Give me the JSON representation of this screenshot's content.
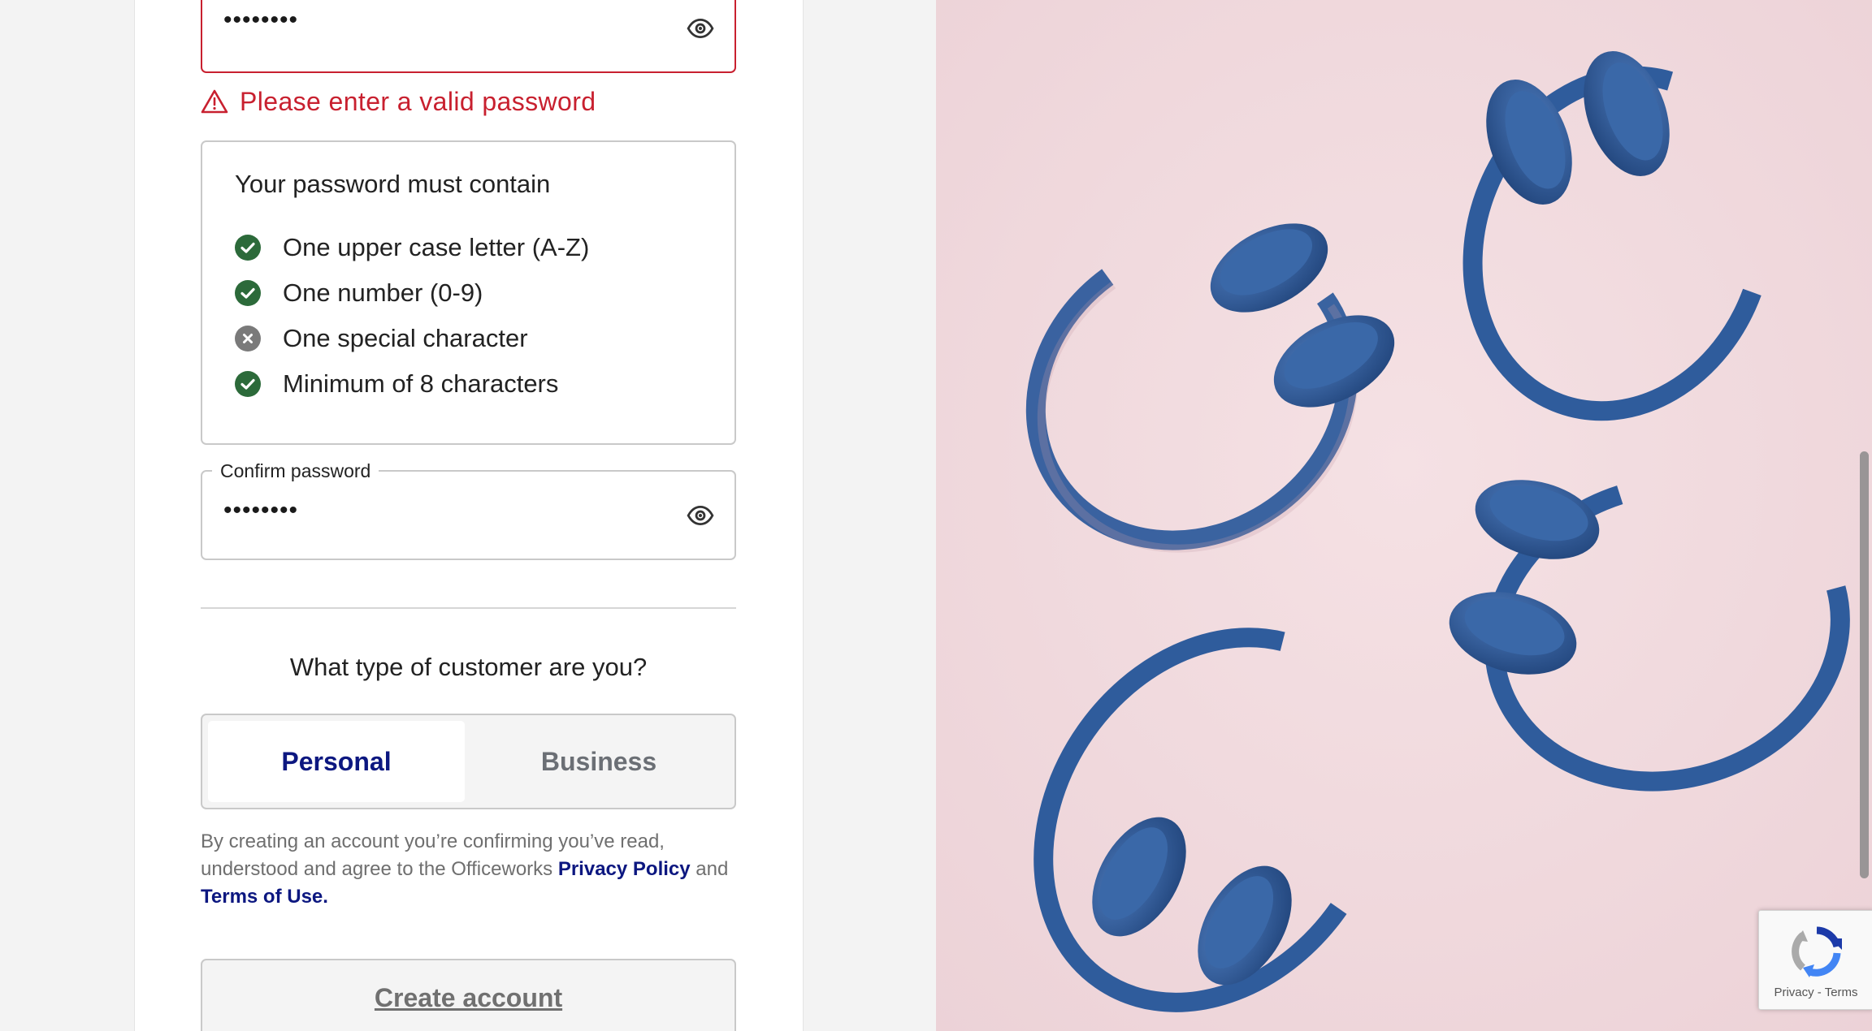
{
  "password": {
    "masked_value": "••••••••",
    "error_message": "Please enter a valid password"
  },
  "requirements": {
    "title": "Your password must contain",
    "items": [
      {
        "label": "One upper case letter (A-Z)",
        "status": "met"
      },
      {
        "label": "One number (0-9)",
        "status": "met"
      },
      {
        "label": "One special character",
        "status": "unmet"
      },
      {
        "label": "Minimum of 8 characters",
        "status": "met"
      }
    ]
  },
  "confirm_password": {
    "label": "Confirm password",
    "masked_value": "••••••••"
  },
  "customer_type": {
    "question": "What type of customer are you?",
    "options": [
      "Personal",
      "Business"
    ],
    "selected": "Personal"
  },
  "terms": {
    "prefix": "By creating an account you’re confirming you’ve read, understood and agree to the Officeworks ",
    "privacy_link": "Privacy Policy",
    "middle": " and ",
    "terms_link": "Terms of Use."
  },
  "create_button": "Create account",
  "recaptcha": {
    "privacy": "Privacy",
    "separator": " - ",
    "terms": "Terms"
  },
  "colors": {
    "error": "#c8202f",
    "success": "#2c6a3a",
    "unmet": "#7a7a7a",
    "link": "#0c1780",
    "headphone_blue": "#2f5c9c",
    "background_pink": "#f1d9dd"
  }
}
